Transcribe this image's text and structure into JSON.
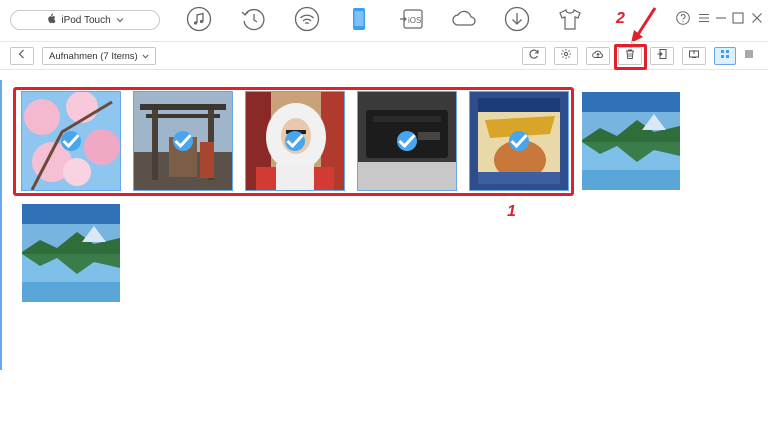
{
  "device": {
    "name": "iPod Touch"
  },
  "toolbar": {
    "album_label": "Aufnahmen (7 Items)"
  },
  "photos": [
    {
      "subject": "cherry-blossom",
      "selected": true
    },
    {
      "subject": "shrine-gate",
      "selected": true
    },
    {
      "subject": "person-hood",
      "selected": true
    },
    {
      "subject": "game-console",
      "selected": true
    },
    {
      "subject": "manga-cover",
      "selected": true
    },
    {
      "subject": "mountain-lake",
      "selected": false
    },
    {
      "subject": "mountain-lake",
      "selected": false
    }
  ],
  "annotations": {
    "step1": "1",
    "step2": "2"
  },
  "colors": {
    "accent": "#49a6ec",
    "highlight": "#e0202a"
  }
}
